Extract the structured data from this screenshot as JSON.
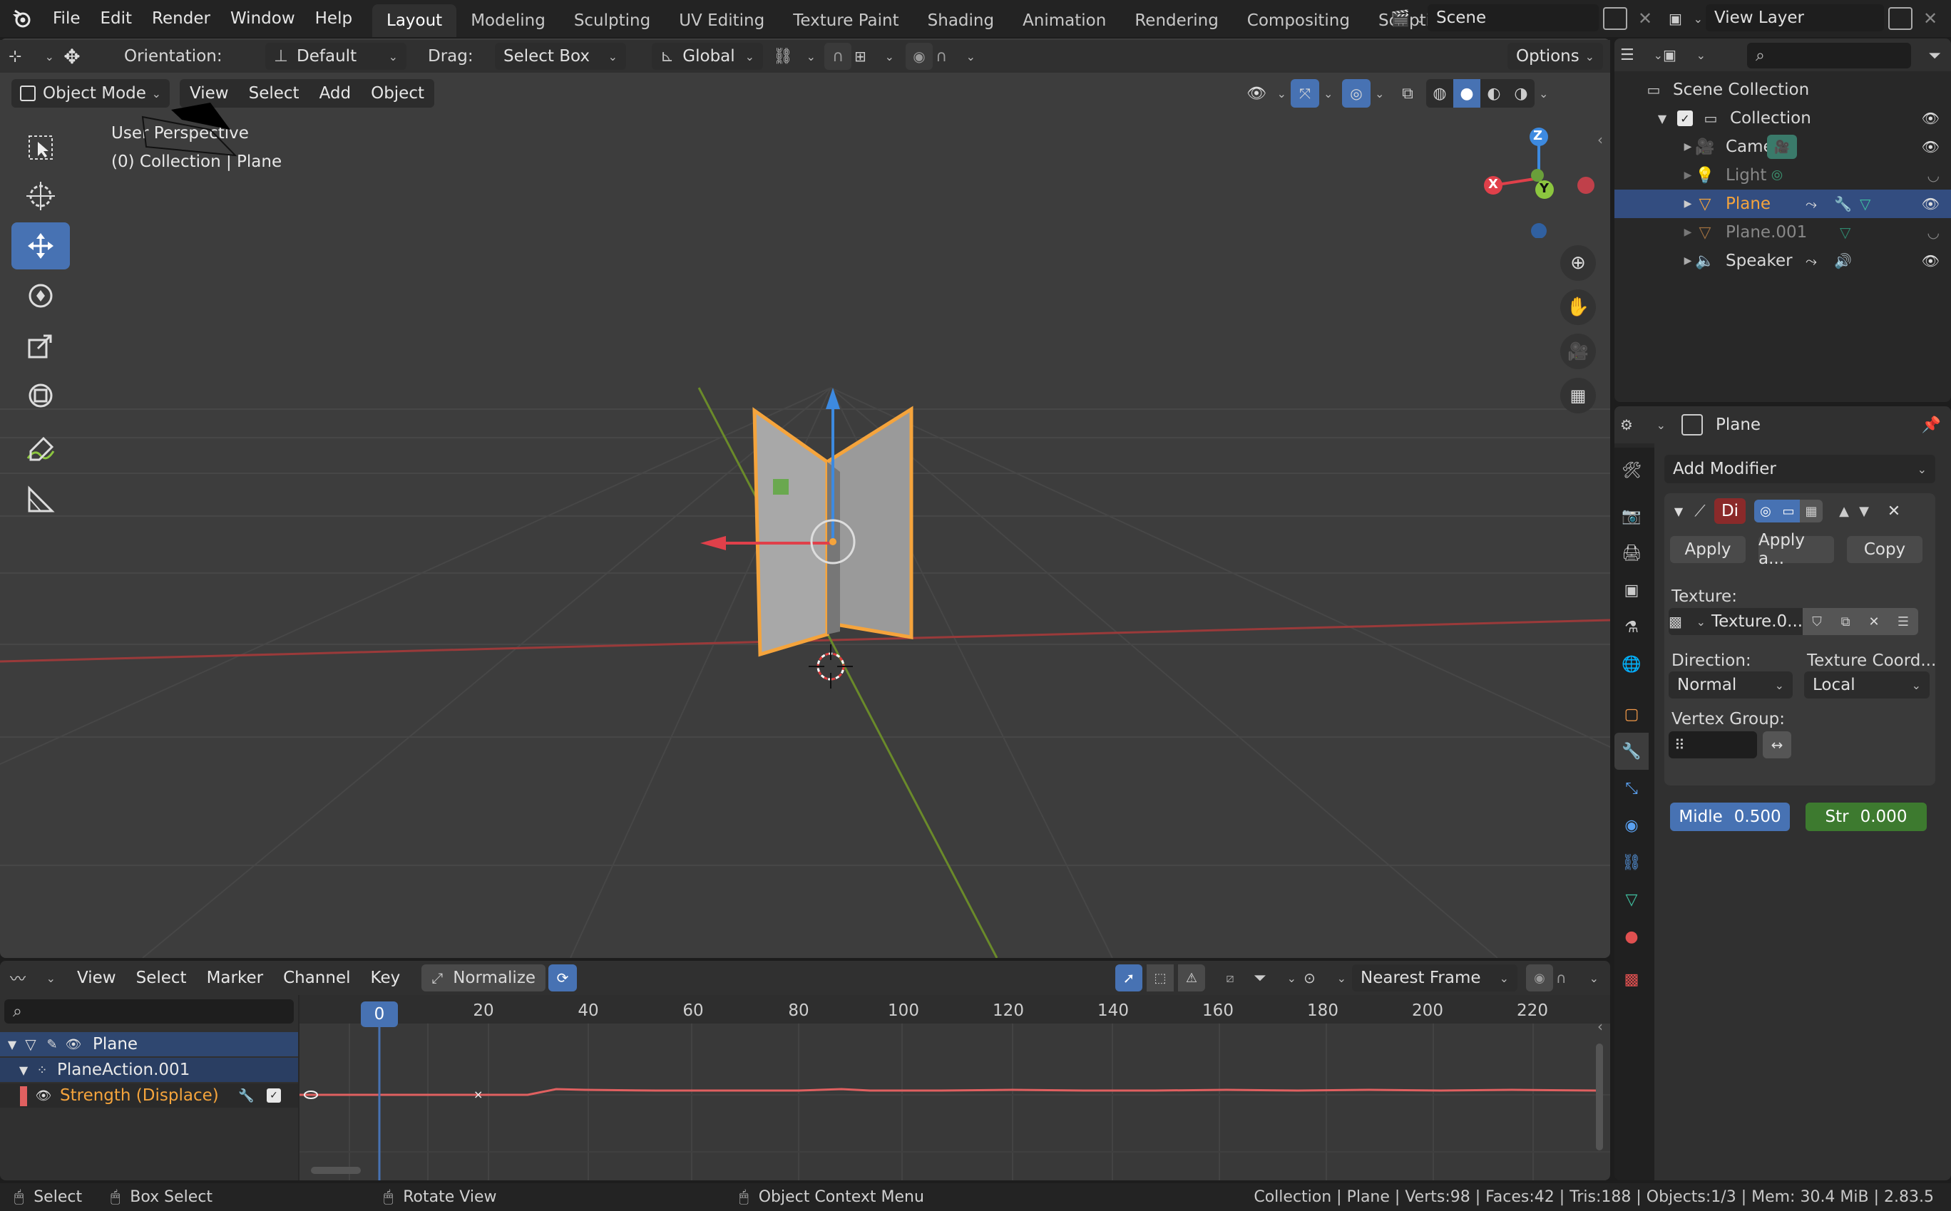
{
  "topbar": {
    "menus": [
      "File",
      "Edit",
      "Render",
      "Window",
      "Help"
    ],
    "workspaces": [
      {
        "label": "Layout",
        "active": true
      },
      {
        "label": "Modeling"
      },
      {
        "label": "Sculpting"
      },
      {
        "label": "UV Editing"
      },
      {
        "label": "Texture Paint"
      },
      {
        "label": "Shading"
      },
      {
        "label": "Animation"
      },
      {
        "label": "Rendering"
      },
      {
        "label": "Compositing"
      },
      {
        "label": "Scriptin"
      }
    ],
    "scene": "Scene",
    "view_layer": "View Layer"
  },
  "tool_header": {
    "orientation_label": "Orientation:",
    "orientation_value": "Default",
    "drag_label": "Drag:",
    "drag_value": "Select Box",
    "transform_space": "Global",
    "options_label": "Options"
  },
  "viewport_header": {
    "mode": "Object Mode",
    "menus": [
      "View",
      "Select",
      "Add",
      "Object"
    ]
  },
  "viewport": {
    "perspective": "User Perspective",
    "context": "(0) Collection | Plane",
    "gizmo": {
      "x": "X",
      "y": "Y",
      "z": "Z"
    }
  },
  "outliner": {
    "search_placeholder": "",
    "root": "Scene Collection",
    "collection": "Collection",
    "items": [
      {
        "label": "Camera",
        "visible": true
      },
      {
        "label": "Light",
        "visible": false,
        "dim": true
      },
      {
        "label": "Plane",
        "visible": true,
        "selected": true
      },
      {
        "label": "Plane.001",
        "visible": false,
        "dim": true
      },
      {
        "label": "Speaker",
        "visible": true
      }
    ]
  },
  "properties": {
    "object_name": "Plane",
    "add_modifier": "Add Modifier",
    "modifier_name": "Di",
    "apply": "Apply",
    "apply_as": "Apply a...",
    "copy": "Copy",
    "texture_label": "Texture:",
    "texture_value": "Texture.0...",
    "direction_label": "Direction:",
    "direction_value": "Normal",
    "texcoord_label": "Texture Coord...",
    "texcoord_value": "Local",
    "vertex_group_label": "Vertex Group:",
    "midlevel_label": "Midle",
    "midlevel_value": "0.500",
    "strength_label": "Str",
    "strength_value": "0.000"
  },
  "graph_editor": {
    "menus": [
      "View",
      "Select",
      "Marker",
      "Channel",
      "Key"
    ],
    "normalize": "Normalize",
    "pivot": "Nearest Frame",
    "current_frame": "0",
    "ticks": [
      "20",
      "40",
      "60",
      "80",
      "100",
      "120",
      "140",
      "160",
      "180",
      "200",
      "220"
    ],
    "channels": [
      {
        "label": "Plane",
        "level": 0
      },
      {
        "label": "PlaneAction.001",
        "level": 1
      },
      {
        "label": "Strength (Displace)",
        "level": 2
      }
    ],
    "curve_color": "#e06060"
  },
  "statusbar": {
    "select": "Select",
    "box_select": "Box Select",
    "rotate_view": "Rotate View",
    "context_menu": "Object Context Menu",
    "stats": "Collection | Plane | Verts:98 | Faces:42 | Tris:188 | Objects:1/3 | Mem: 30.4 MiB | 2.83.5"
  },
  "colors": {
    "accent": "#4772b3",
    "selected_orange": "#f5a43c",
    "strength_green": "#3d7a2f",
    "x_axis": "#e0404a",
    "y_axis": "#8cc63f",
    "z_axis": "#3d8ae0"
  }
}
